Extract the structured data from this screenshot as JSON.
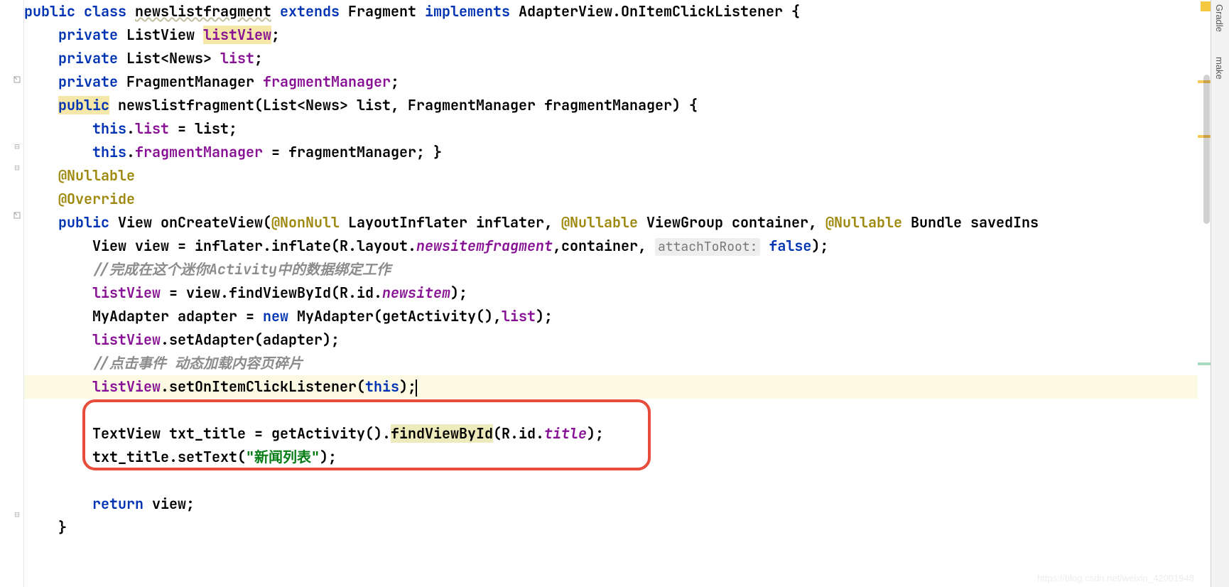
{
  "code": {
    "l1": {
      "public": "public",
      "class": "class",
      "name": "newslistfragment",
      "extends": "extends",
      "parent": "Fragment",
      "implements": "implements",
      "iface": "AdapterView.OnItemClickListener",
      "brace": " {"
    },
    "l2": {
      "private": "private",
      "type": "ListView",
      "field": "listView",
      "end": ";"
    },
    "l3": {
      "private": "private",
      "type": "List<News>",
      "field": "list",
      "end": ";"
    },
    "l4": {
      "private": "private",
      "type": "FragmentManager",
      "field": "fragmentManager",
      "end": ";"
    },
    "l5": {
      "public": "public",
      "ctor": "newslistfragment(List<News> list, FragmentManager fragmentManager) {"
    },
    "l6": {
      "this": "this",
      "dot": ".",
      "field": "list",
      "assign": " = list;"
    },
    "l7": {
      "this": "this",
      "dot": ".",
      "field": "fragmentManager",
      "assign": " = fragmentManager; }"
    },
    "l8": {
      "ann": "@Nullable"
    },
    "l9": {
      "ann": "@Override"
    },
    "l10": {
      "public": "public",
      "rtype": "View",
      "method": "onCreateView(",
      "a1": "@NonNull",
      "p1": " LayoutInflater inflater, ",
      "a2": "@Nullable",
      "p2": " ViewGroup container, ",
      "a3": "@Nullable",
      "p3": " Bundle savedIns"
    },
    "l11": {
      "pre": "View view = inflater.inflate(R.layout.",
      "res": "newsitemfragment",
      "mid": ",container, ",
      "hint": "attachToRoot:",
      "val": "false",
      "end": ");"
    },
    "l12": {
      "cmt": "//完成在这个迷你Activity中的数据绑定工作"
    },
    "l13": {
      "field": "listView",
      "rest": " = view.findViewById(R.id.",
      "res": "newsitem",
      "end": ");"
    },
    "l14": {
      "pre": "MyAdapter adapter = ",
      "new": "new",
      "rest": " MyAdapter(getActivity(),",
      "field": "list",
      "end": ");"
    },
    "l15": {
      "field": "listView",
      "rest": ".setAdapter(adapter);"
    },
    "l16": {
      "cmt": "//点击事件 动态加载内容页碎片"
    },
    "l17": {
      "field": "listView",
      "rest": ".setOnItemClickListener(",
      "this": "this",
      "end": ");"
    },
    "l19": {
      "pre": "TextView txt_title = getActivity().",
      "find": "findViewById",
      "mid": "(R.id.",
      "res": "title",
      "end": ");"
    },
    "l20": {
      "pre": "txt_title.setText(",
      "str": "\"新闻列表\"",
      "end": ");"
    },
    "l22": {
      "return": "return",
      "rest": " view;"
    },
    "l23": {
      "brace": "}"
    }
  },
  "toolWindows": {
    "gradle": "Gradle",
    "make": "make"
  },
  "watermark": "https://blog.csdn.net/weixin_42001948"
}
